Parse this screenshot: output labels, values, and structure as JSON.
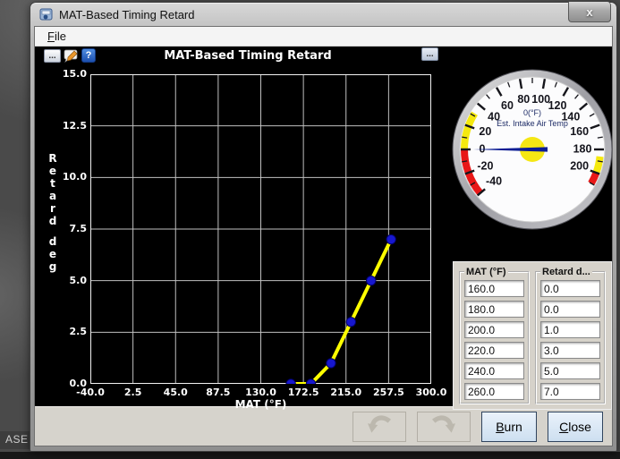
{
  "window": {
    "title": "MAT-Based Timing Retard",
    "close": "x"
  },
  "menu": {
    "file": "File"
  },
  "chart": {
    "title": "MAT-Based Timing Retard",
    "more_left": "...",
    "more_right": "...",
    "help": "?",
    "ylabel": "Retard deg",
    "xlabel": "MAT (°F)"
  },
  "chart_data": {
    "type": "line",
    "title": "MAT-Based Timing Retard",
    "xlabel": "MAT (°F)",
    "ylabel": "Retard deg",
    "x": [
      160,
      180,
      200,
      220,
      240,
      260
    ],
    "y": [
      0,
      0,
      1,
      3,
      5,
      7
    ],
    "xlim": [
      -40,
      300
    ],
    "ylim": [
      0,
      15
    ],
    "xtick_labels": [
      "-40.0",
      "2.5",
      "45.0",
      "87.5",
      "130.0",
      "172.5",
      "215.0",
      "257.5",
      "300.0"
    ],
    "ytick_labels": [
      "15.0",
      "12.5",
      "10.0",
      "7.5",
      "5.0",
      "2.5",
      "0.0"
    ],
    "grid": true,
    "legend": "none",
    "plot_bg": "#000000",
    "grid_color": "#c0c0c0",
    "line_color": "#ffff00",
    "marker_color": "#1717cf"
  },
  "gauge": {
    "value": 0,
    "value_text": "0(°F)",
    "label": "Est. Intake Air Temp",
    "min": -40,
    "max": 210,
    "minor_step": 10,
    "major_step": 20,
    "major_labels": [
      "-40",
      "-20",
      "0",
      "20",
      "40",
      "60",
      "80",
      "100",
      "120",
      "140",
      "160",
      "180",
      "200"
    ],
    "zones": [
      {
        "from": -40,
        "to": 0,
        "color": "#e81717"
      },
      {
        "from": 0,
        "to": 32,
        "color": "#f5e90f"
      },
      {
        "from": 186,
        "to": 200,
        "color": "#f5e90f"
      },
      {
        "from": 200,
        "to": 210,
        "color": "#e81717"
      }
    ],
    "needle_color": "#0c1d94",
    "hub_color": "#f5e714",
    "text_color": "#1d2b66"
  },
  "panel": {
    "groups": [
      {
        "title": "MAT (°F)",
        "values": [
          "160.0",
          "180.0",
          "200.0",
          "220.0",
          "240.0",
          "260.0"
        ]
      },
      {
        "title": "Retard d...",
        "values": [
          "0.0",
          "0.0",
          "1.0",
          "3.0",
          "5.0",
          "7.0"
        ]
      }
    ]
  },
  "footer": {
    "burn": "Burn",
    "close": "Close"
  },
  "desktop": {
    "partial_text": "ASE OF"
  }
}
